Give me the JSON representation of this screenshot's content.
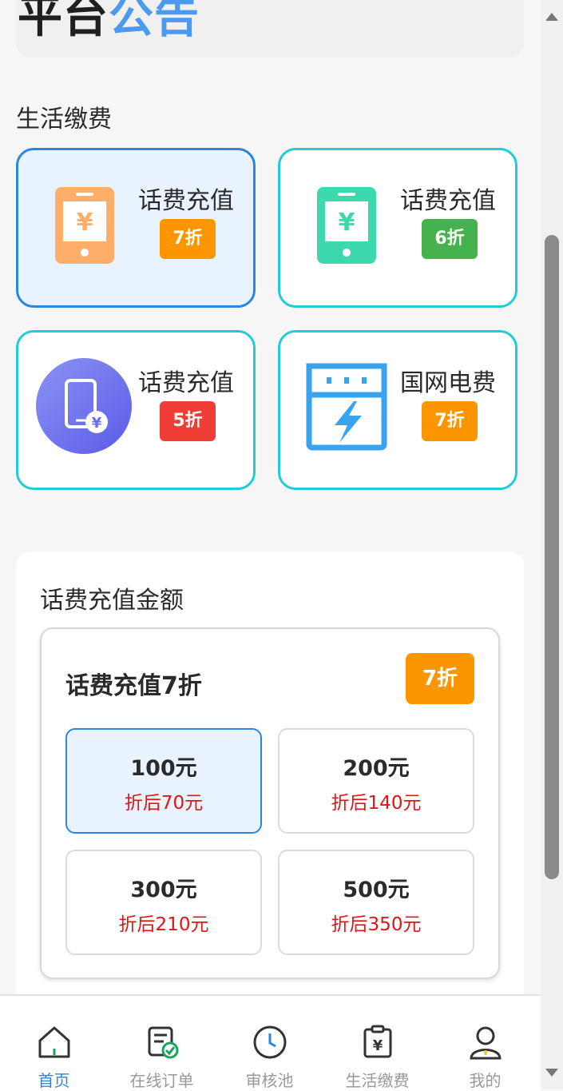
{
  "announcement": {
    "part1": "平台",
    "part2": "公告"
  },
  "section_title": "生活缴费",
  "services": [
    {
      "label": "话费充值",
      "discount": "7折",
      "icon": "phone-recharge-orange-icon",
      "tag_color": "#fb9600",
      "selected": true
    },
    {
      "label": "话费充值",
      "discount": "6折",
      "icon": "phone-recharge-green-icon",
      "tag_color": "#46b24e",
      "selected": false
    },
    {
      "label": "话费充值",
      "discount": "5折",
      "icon": "phone-recharge-purple-icon",
      "tag_color": "#ef3e36",
      "selected": false
    },
    {
      "label": "国网电费",
      "discount": "7折",
      "icon": "electric-meter-icon",
      "tag_color": "#fb9600",
      "selected": false
    }
  ],
  "amount_panel": {
    "title": "话费充值金额",
    "card_title": "话费充值7折",
    "badge": "7折",
    "options": [
      {
        "value": "100元",
        "discounted": "折后70元",
        "selected": true
      },
      {
        "value": "200元",
        "discounted": "折后140元",
        "selected": false
      },
      {
        "value": "300元",
        "discounted": "折后210元",
        "selected": false
      },
      {
        "value": "500元",
        "discounted": "折后350元",
        "selected": false
      }
    ]
  },
  "tabbar": {
    "items": [
      {
        "label": "首页",
        "icon": "home-icon",
        "active": true
      },
      {
        "label": "在线订单",
        "icon": "order-check-icon",
        "active": false
      },
      {
        "label": "审核池",
        "icon": "clock-icon",
        "active": false
      },
      {
        "label": "生活缴费",
        "icon": "bill-yen-icon",
        "active": false
      },
      {
        "label": "我的",
        "icon": "user-icon",
        "active": false
      }
    ]
  },
  "colors": {
    "accent": "#2b86dc",
    "cyan_border": "#22ccd6",
    "price_red": "#e01515"
  }
}
